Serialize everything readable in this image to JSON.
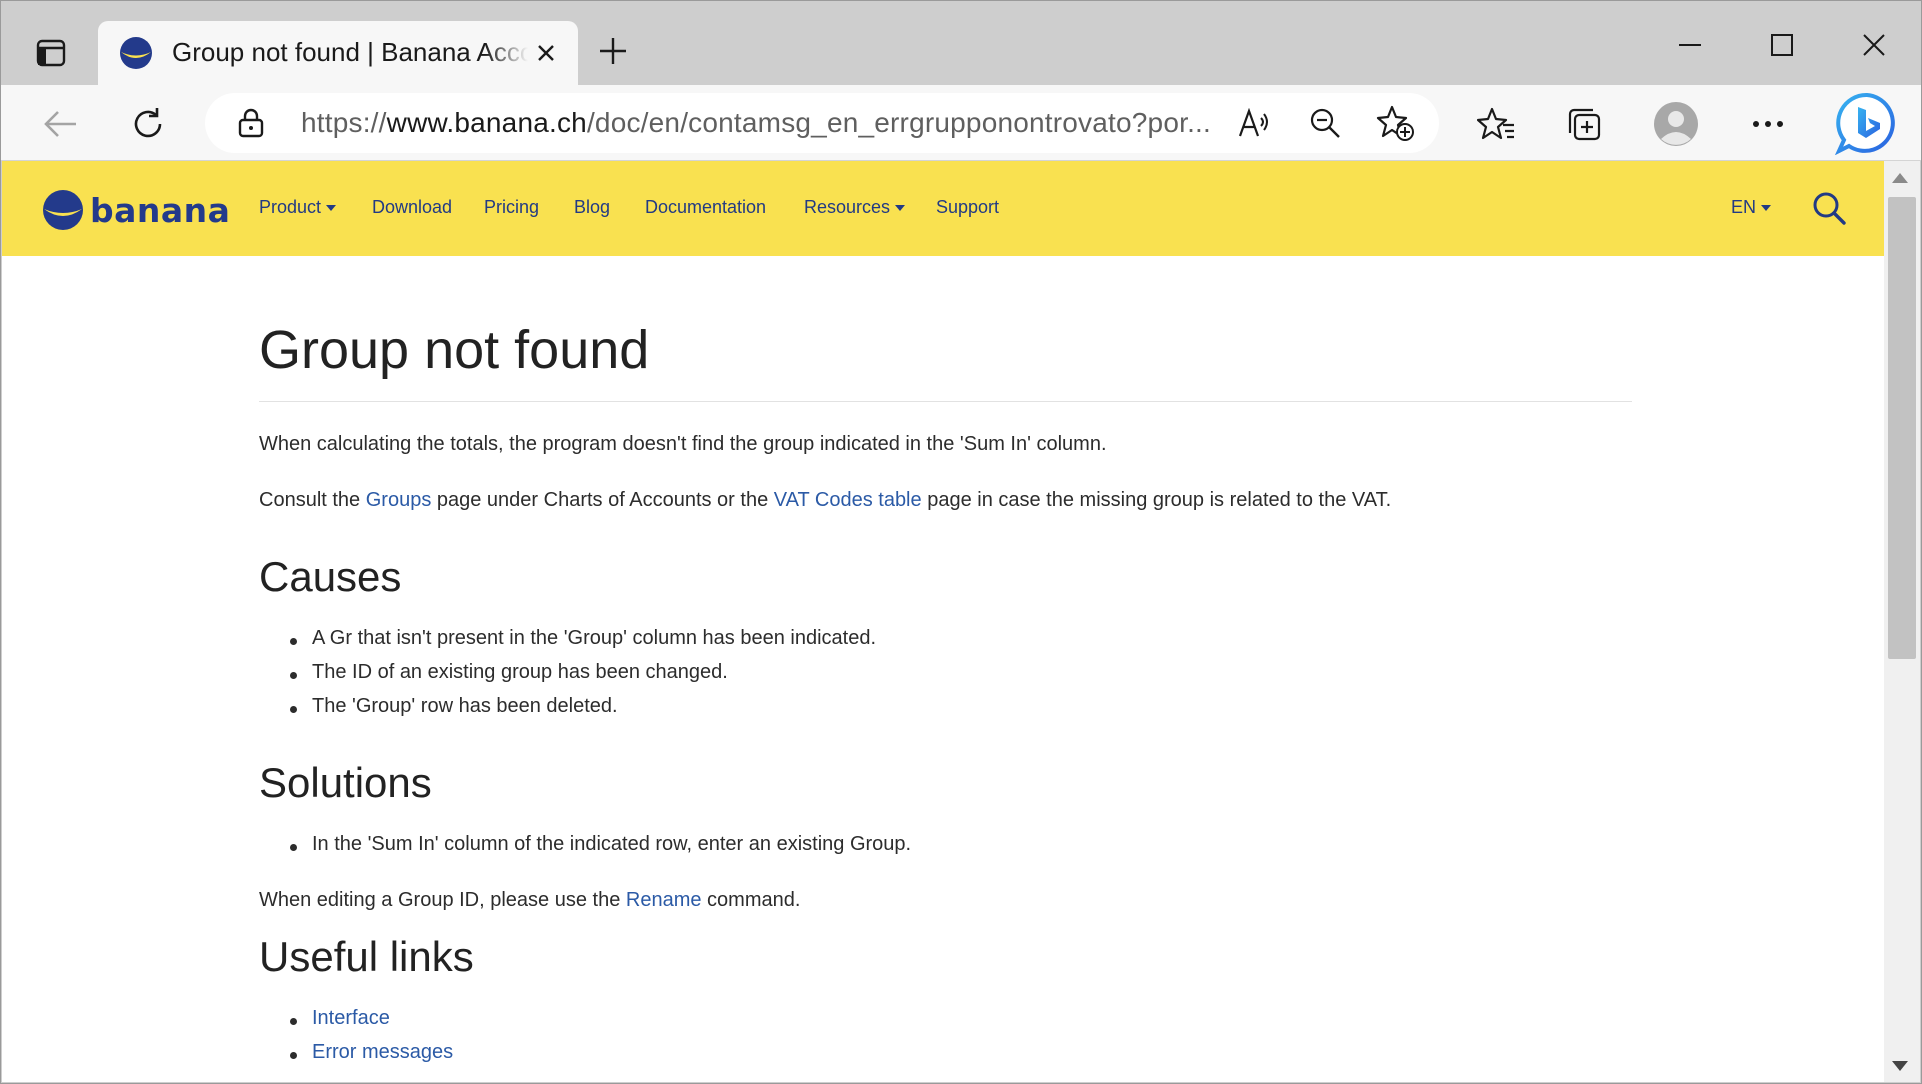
{
  "browser": {
    "tab_title": "Group not found | Banana Accounting Software",
    "url_prefix": "https://",
    "url_host": "www.banana.ch",
    "url_path": "/doc/en/contamsg_en_errgrupponontrovato?por...",
    "icons": {
      "tab_actions": "tab-actions-icon",
      "close_tab": "close-icon",
      "new_tab": "plus-icon",
      "minimize": "minimize-icon",
      "maximize": "maximize-icon",
      "close_window": "close-icon",
      "back": "back-arrow-icon",
      "refresh": "refresh-icon",
      "lock": "lock-icon",
      "read_aloud": "read-aloud-icon",
      "zoom_out": "zoom-out-icon",
      "add_favorite": "star-plus-icon",
      "favorites": "favorites-icon",
      "collections": "collections-icon",
      "profile": "profile-avatar",
      "more": "more-dots-icon",
      "bing": "bing-chat-icon"
    }
  },
  "site": {
    "logo_text": "banana",
    "nav": [
      {
        "label": "Product",
        "dropdown": true
      },
      {
        "label": "Download",
        "dropdown": false
      },
      {
        "label": "Pricing",
        "dropdown": false
      },
      {
        "label": "Blog",
        "dropdown": false
      },
      {
        "label": "Documentation",
        "dropdown": false
      },
      {
        "label": "Resources",
        "dropdown": true
      },
      {
        "label": "Support",
        "dropdown": false
      }
    ],
    "language": "EN",
    "colors": {
      "nav_bg": "#f9e150",
      "brand_blue": "#233a8b",
      "link": "#2b5aa6"
    }
  },
  "article": {
    "title": "Group not found",
    "intro": "When calculating the totals, the program doesn't find the group indicated in the 'Sum In' column.",
    "consult": {
      "t1": "Consult the ",
      "link1": "Groups",
      "t2": " page under Charts of Accounts or the ",
      "link2": "VAT Codes table",
      "t3": " page in case the missing group is related to the VAT."
    },
    "causes_heading": "Causes",
    "causes": [
      "A Gr that isn't present in the 'Group' column has been indicated.",
      "The ID of an existing group has been changed.",
      "The 'Group' row has been deleted."
    ],
    "solutions_heading": "Solutions",
    "solutions": [
      "In the 'Sum In' column of the indicated row, enter an existing Group."
    ],
    "rename": {
      "t1": "When editing a Group ID, please use the ",
      "link": "Rename",
      "t2": " command."
    },
    "links_heading": "Useful links",
    "links": [
      "Interface",
      "Error messages"
    ]
  }
}
